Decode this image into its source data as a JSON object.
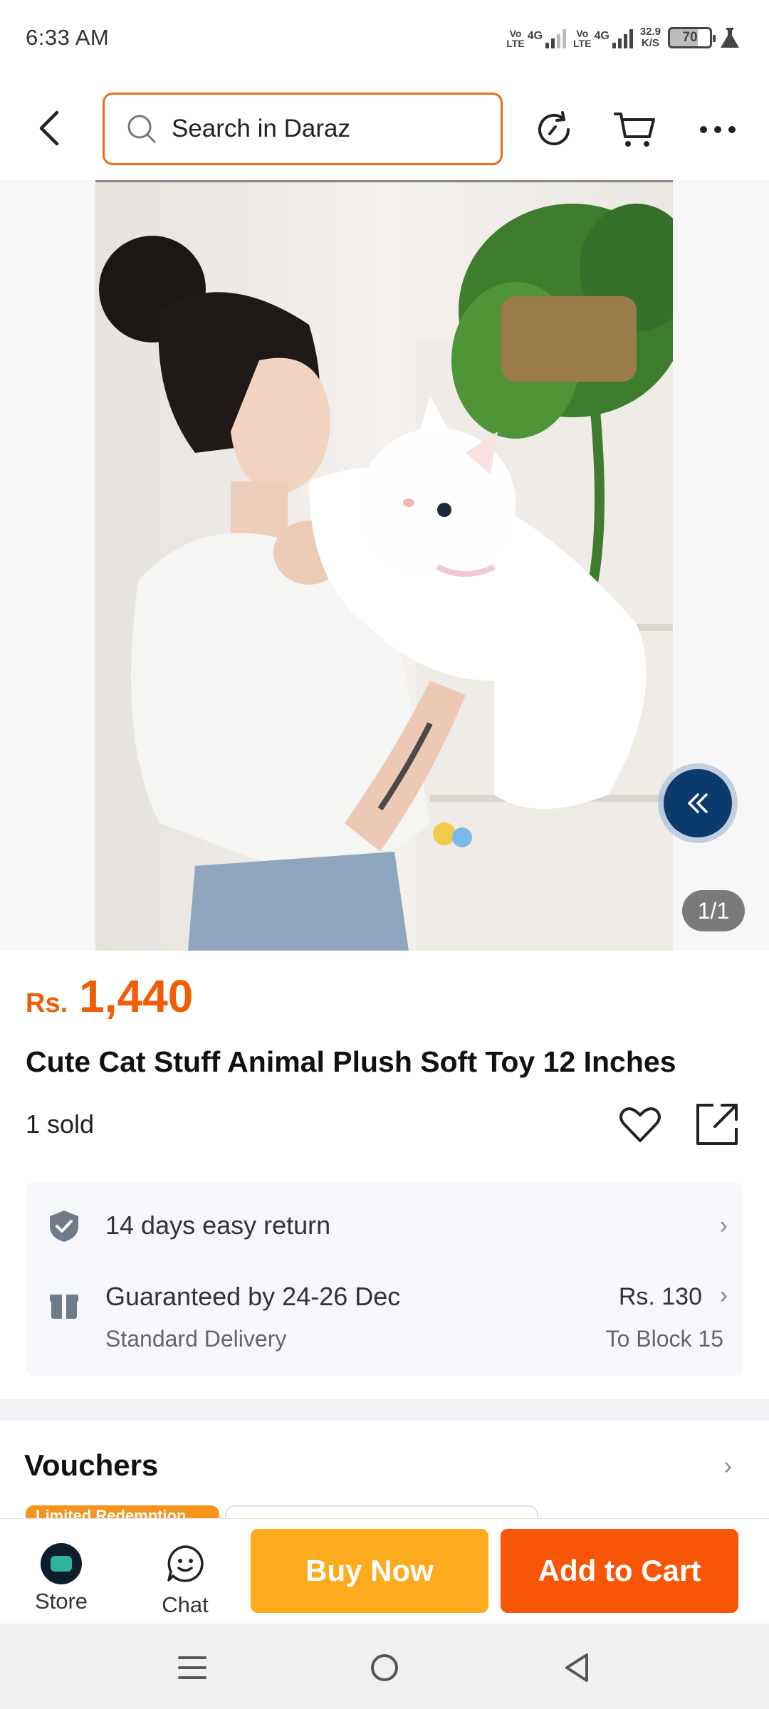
{
  "status_bar": {
    "time": "6:33 AM",
    "sim1_tag": "Vo\nLTE",
    "sim1_net": "4G",
    "sim2_tag": "Vo\nLTE",
    "sim2_net": "4G",
    "speed_value": "32.9",
    "speed_unit": "K/S",
    "battery": "70"
  },
  "header": {
    "search_placeholder": "Search in Daraz",
    "back_icon": "back-arrow-icon",
    "icons": [
      "refresh-icon",
      "cart-icon",
      "more-icon"
    ]
  },
  "gallery": {
    "counter": "1/1",
    "collapse_icon": "double-chevron-left-icon"
  },
  "product": {
    "currency": "Rs.",
    "price": "1,440",
    "title": "Cute Cat Stuff Animal Plush Soft Toy 12 Inches",
    "sold": "1 sold"
  },
  "info": {
    "return_text": "14 days easy return",
    "delivery_text": "Guaranteed by 24-26 Dec",
    "delivery_sub": "Standard Delivery",
    "delivery_fee": "Rs. 130",
    "delivery_to": "To Block 15"
  },
  "vouchers": {
    "title": "Vouchers",
    "badge": "Limited Redemption"
  },
  "action_bar": {
    "store_label": "Store",
    "chat_label": "Chat",
    "buy_label": "Buy Now",
    "cart_label": "Add to Cart"
  },
  "colors": {
    "accent": "#f85606",
    "buy_now": "#fbab1c",
    "price": "#f25c05",
    "search_border": "#f06a1a"
  }
}
